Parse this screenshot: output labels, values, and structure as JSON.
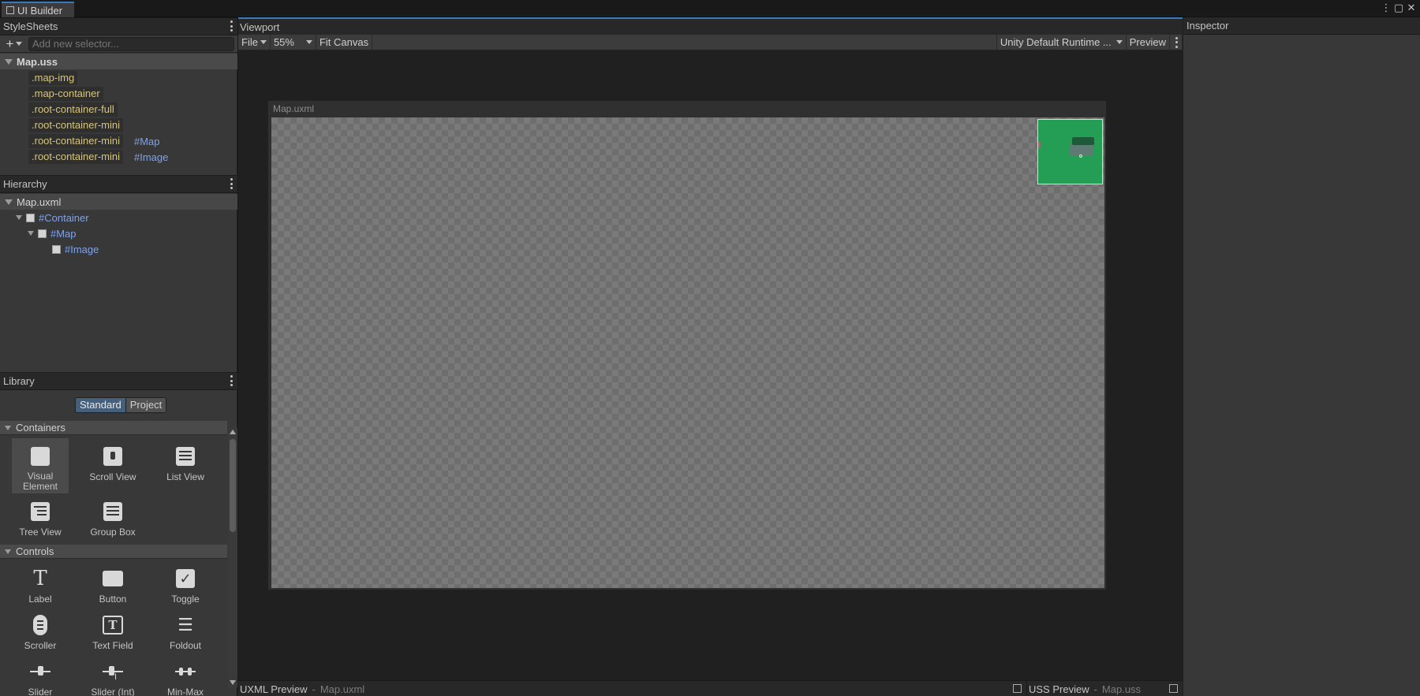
{
  "window": {
    "tab_title": "UI Builder"
  },
  "stylesheets": {
    "header": "StyleSheets",
    "add_selector_placeholder": "Add new selector...",
    "file": "Map.uss",
    "selectors": [
      {
        "name": ".map-img",
        "ref": ""
      },
      {
        "name": ".map-container",
        "ref": ""
      },
      {
        "name": ".root-container-full",
        "ref": ""
      },
      {
        "name": ".root-container-mini",
        "ref": ""
      },
      {
        "name": ".root-container-mini",
        "ref": "#Map"
      },
      {
        "name": ".root-container-mini",
        "ref": "#Image"
      }
    ]
  },
  "hierarchy": {
    "header": "Hierarchy",
    "document": "Map.uxml",
    "nodes": [
      {
        "label": "#Container",
        "depth": 0
      },
      {
        "label": "#Map",
        "depth": 1
      },
      {
        "label": "#Image",
        "depth": 2
      }
    ]
  },
  "library": {
    "header": "Library",
    "tabs": {
      "standard": "Standard",
      "project": "Project"
    },
    "categories": {
      "containers": "Containers",
      "controls": "Controls"
    },
    "containers": [
      {
        "label": "Visual Element",
        "icon": "visual-element-icon"
      },
      {
        "label": "Scroll View",
        "icon": "scroll-view-icon"
      },
      {
        "label": "List View",
        "icon": "list-view-icon"
      },
      {
        "label": "Tree View",
        "icon": "tree-view-icon"
      },
      {
        "label": "Group Box",
        "icon": "group-box-icon"
      }
    ],
    "controls": [
      {
        "label": "Label",
        "icon": "label-icon"
      },
      {
        "label": "Button",
        "icon": "button-icon"
      },
      {
        "label": "Toggle",
        "icon": "toggle-icon"
      },
      {
        "label": "Scroller",
        "icon": "scroller-icon"
      },
      {
        "label": "Text Field",
        "icon": "text-field-icon"
      },
      {
        "label": "Foldout",
        "icon": "foldout-icon"
      },
      {
        "label": "Slider",
        "icon": "slider-icon"
      },
      {
        "label": "Slider (Int)",
        "icon": "slider-int-icon"
      },
      {
        "label": "Min-Max",
        "icon": "min-max-slider-icon"
      }
    ]
  },
  "viewport": {
    "header": "Viewport",
    "file_menu": "File",
    "zoom": "55%",
    "fit_canvas": "Fit Canvas",
    "theme": "Unity Default Runtime ...",
    "preview": "Preview",
    "canvas_title": "Map.uxml"
  },
  "bottom": {
    "uxml_preview": "UXML Preview",
    "uxml_file": "Map.uxml",
    "uss_preview": "USS Preview",
    "uss_file": "Map.uss"
  },
  "inspector": {
    "header": "Inspector"
  },
  "colors": {
    "accent": "#3a79bb",
    "selector_text": "#d6c57a",
    "reference_text": "#7fa2e6",
    "map_image": "#249d55"
  }
}
